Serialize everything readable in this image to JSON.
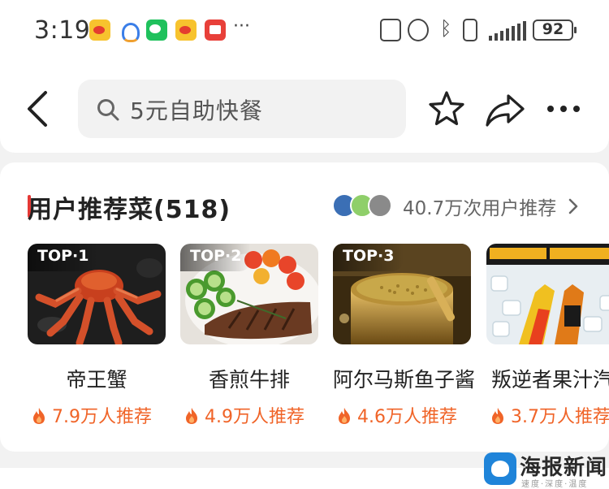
{
  "status_bar": {
    "time": "3:19",
    "notification_icons": [
      "weibo-icon",
      "app-icon",
      "wechat-icon",
      "weibo-icon",
      "red-app-icon"
    ],
    "overflow": "···",
    "system_icons": [
      "nfc-icon",
      "alarm-icon",
      "bluetooth-icon",
      "vibrate-icon",
      "signal-icon"
    ],
    "battery": "92"
  },
  "nav": {
    "search_placeholder": "5元自助快餐",
    "icons": [
      "back-icon",
      "search-icon",
      "star-icon",
      "share-icon",
      "more-icon"
    ]
  },
  "recommend": {
    "title": "用户推荐菜(518)",
    "summary": "40.7万次用户推荐",
    "dishes": [
      {
        "badge": "TOP·1",
        "name": "帝王蟹",
        "rec": "7.9万人推荐"
      },
      {
        "badge": "TOP·2",
        "name": "香煎牛排",
        "rec": "4.9万人推荐"
      },
      {
        "badge": "TOP·3",
        "name": "阿尔马斯鱼子酱",
        "rec": "4.6万人推荐"
      },
      {
        "badge": "",
        "name": "叛逆者果汁汽水",
        "rec": "3.7万人推荐"
      }
    ]
  },
  "watermark": {
    "name": "海报新闻",
    "slogan": "速度·深度·温度"
  },
  "colors": {
    "accent": "#e53935",
    "recommend_orange": "#f06428",
    "background": "#f2f2f2"
  }
}
